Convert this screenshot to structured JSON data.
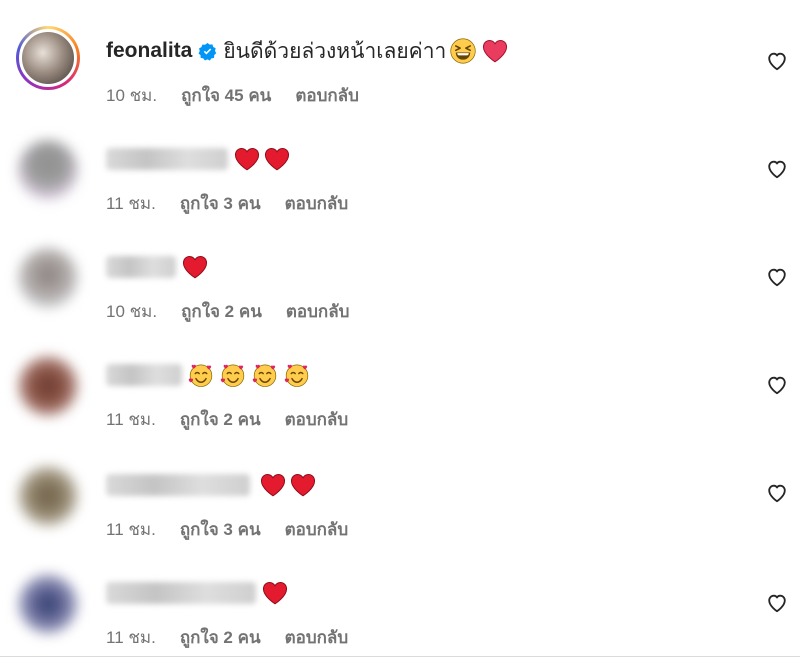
{
  "comments": [
    {
      "username": "feonalita",
      "verified": true,
      "text": "ยินดีด้วยล่วงหน้าเลยค่าา",
      "emojis": [
        "grinning-squinting-face",
        "heart"
      ],
      "time": "10 ชม.",
      "likes": "ถูกใจ 45 คน",
      "reply": "ตอบกลับ"
    },
    {
      "username": "",
      "verified": false,
      "text": "",
      "emojis": [
        "heart",
        "heart"
      ],
      "time": "11 ชม.",
      "likes": "ถูกใจ 3 คน",
      "reply": "ตอบกลับ"
    },
    {
      "username": "",
      "verified": false,
      "text": "",
      "emojis": [
        "heart"
      ],
      "time": "10 ชม.",
      "likes": "ถูกใจ 2 คน",
      "reply": "ตอบกลับ"
    },
    {
      "username": "",
      "verified": false,
      "text": "",
      "emojis": [
        "smiling-face-with-hearts",
        "smiling-face-with-hearts",
        "smiling-face-with-hearts",
        "smiling-face-with-hearts"
      ],
      "time": "11 ชม.",
      "likes": "ถูกใจ 2 คน",
      "reply": "ตอบกลับ"
    },
    {
      "username": "",
      "verified": false,
      "text": "",
      "emojis": [
        "heart",
        "heart"
      ],
      "time": "11 ชม.",
      "likes": "ถูกใจ 3 คน",
      "reply": "ตอบกลับ"
    },
    {
      "username": "",
      "verified": false,
      "text": "",
      "emojis": [
        "heart"
      ],
      "time": "11 ชม.",
      "likes": "ถูกใจ 2 คน",
      "reply": "ตอบกลับ"
    }
  ],
  "icons": {
    "like": "heart-outline-icon",
    "verified": "verified-badge-icon"
  },
  "colors": {
    "verified_blue": "#0095f6",
    "heart_red": "#e0245e",
    "meta_gray": "#737373"
  }
}
